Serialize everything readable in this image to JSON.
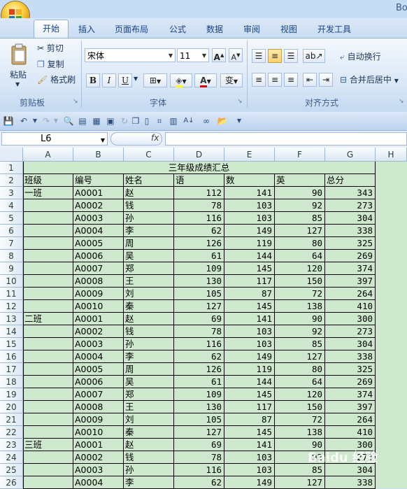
{
  "app": {
    "title_fragment": "Bo"
  },
  "tabs": [
    {
      "label": "开始",
      "active": true
    },
    {
      "label": "插入"
    },
    {
      "label": "页面布局"
    },
    {
      "label": "公式"
    },
    {
      "label": "数据"
    },
    {
      "label": "审阅"
    },
    {
      "label": "视图"
    },
    {
      "label": "开发工具"
    }
  ],
  "clipboard": {
    "paste": "粘贴",
    "cut": "剪切",
    "copy": "复制",
    "format_painter": "格式刷",
    "group": "剪贴板"
  },
  "font": {
    "name": "宋体",
    "size": "11",
    "grow": "A",
    "shrink": "A",
    "bold": "B",
    "italic": "I",
    "underline": "U",
    "phonetic": "变",
    "group": "字体"
  },
  "alignment": {
    "wrap": "自动换行",
    "merge": "合并后居中",
    "group": "对齐方式"
  },
  "namebox": {
    "value": "L6"
  },
  "formula": {
    "fx": "fx",
    "value": ""
  },
  "columns": [
    "A",
    "B",
    "C",
    "D",
    "E",
    "F",
    "G",
    "H"
  ],
  "rows": [
    "1",
    "2",
    "3",
    "4",
    "5",
    "6",
    "7",
    "8",
    "9",
    "10",
    "11",
    "12",
    "13",
    "14",
    "15",
    "16",
    "17",
    "18",
    "19",
    "20",
    "21",
    "22",
    "23",
    "24",
    "25",
    "26"
  ],
  "sheet": {
    "title": "三年级成绩汇总",
    "headers": [
      "班级",
      "编号",
      "姓名",
      "语",
      "数",
      "英",
      "总分"
    ],
    "data": [
      [
        "一班",
        "A0001",
        "赵",
        "112",
        "141",
        "90",
        "343"
      ],
      [
        "",
        "A0002",
        "钱",
        "78",
        "103",
        "92",
        "273"
      ],
      [
        "",
        "A0003",
        "孙",
        "116",
        "103",
        "85",
        "304"
      ],
      [
        "",
        "A0004",
        "李",
        "62",
        "149",
        "127",
        "338"
      ],
      [
        "",
        "A0005",
        "周",
        "126",
        "119",
        "80",
        "325"
      ],
      [
        "",
        "A0006",
        "吴",
        "61",
        "144",
        "64",
        "269"
      ],
      [
        "",
        "A0007",
        "郑",
        "109",
        "145",
        "120",
        "374"
      ],
      [
        "",
        "A0008",
        "王",
        "130",
        "117",
        "150",
        "397"
      ],
      [
        "",
        "A0009",
        "刘",
        "105",
        "87",
        "72",
        "264"
      ],
      [
        "",
        "A0010",
        "秦",
        "127",
        "145",
        "138",
        "410"
      ],
      [
        "二班",
        "A0001",
        "赵",
        "69",
        "141",
        "90",
        "300"
      ],
      [
        "",
        "A0002",
        "钱",
        "78",
        "103",
        "92",
        "273"
      ],
      [
        "",
        "A0003",
        "孙",
        "116",
        "103",
        "85",
        "304"
      ],
      [
        "",
        "A0004",
        "李",
        "62",
        "149",
        "127",
        "338"
      ],
      [
        "",
        "A0005",
        "周",
        "126",
        "119",
        "80",
        "325"
      ],
      [
        "",
        "A0006",
        "吴",
        "61",
        "144",
        "64",
        "269"
      ],
      [
        "",
        "A0007",
        "郑",
        "109",
        "145",
        "120",
        "374"
      ],
      [
        "",
        "A0008",
        "王",
        "130",
        "117",
        "150",
        "397"
      ],
      [
        "",
        "A0009",
        "刘",
        "105",
        "87",
        "72",
        "264"
      ],
      [
        "",
        "A0010",
        "秦",
        "127",
        "145",
        "138",
        "410"
      ],
      [
        "三班",
        "A0001",
        "赵",
        "69",
        "141",
        "90",
        "300"
      ],
      [
        "",
        "A0002",
        "钱",
        "78",
        "103",
        "92",
        "273"
      ],
      [
        "",
        "A0003",
        "孙",
        "116",
        "103",
        "85",
        "304"
      ],
      [
        "",
        "A0004",
        "李",
        "62",
        "149",
        "127",
        "338"
      ]
    ]
  },
  "watermark": "Baidu 经验",
  "colors": {
    "sheet_fill": "#cde8cd",
    "ribbon_blue": "#15428b"
  }
}
